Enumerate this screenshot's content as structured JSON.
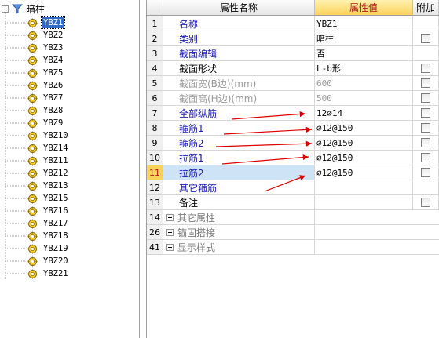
{
  "tree": {
    "root_label": "暗柱",
    "items": [
      "YBZ1",
      "YBZ2",
      "YBZ3",
      "YBZ4",
      "YBZ5",
      "YBZ6",
      "YBZ7",
      "YBZ8",
      "YBZ9",
      "YBZ10",
      "YBZ14",
      "YBZ11",
      "YBZ12",
      "YBZ13",
      "YBZ15",
      "YBZ16",
      "YBZ17",
      "YBZ18",
      "YBZ19",
      "YBZ20",
      "YBZ21"
    ],
    "selected": "YBZ1"
  },
  "grid": {
    "headers": {
      "name": "属性名称",
      "value": "属性值",
      "extra": "附加"
    },
    "rows": [
      {
        "num": "1",
        "name": "名称",
        "value": "YBZ1",
        "checkbox": false
      },
      {
        "num": "2",
        "name": "类别",
        "value": "暗柱",
        "checkbox": true
      },
      {
        "num": "3",
        "name": "截面编辑",
        "value": "否",
        "checkbox": false
      },
      {
        "num": "4",
        "name": "截面形状",
        "value": "L-b形",
        "checkbox": true
      },
      {
        "num": "5",
        "name": "截面宽(B边)(mm)",
        "value": "600",
        "checkbox": true
      },
      {
        "num": "6",
        "name": "截面高(H边)(mm)",
        "value": "500",
        "checkbox": true
      },
      {
        "num": "7",
        "name": "全部纵筋",
        "value": "12⌀14",
        "checkbox": true
      },
      {
        "num": "8",
        "name": "箍筋1",
        "value": "⌀12@150",
        "checkbox": true
      },
      {
        "num": "9",
        "name": "箍筋2",
        "value": "⌀12@150",
        "checkbox": true
      },
      {
        "num": "10",
        "name": "拉筋1",
        "value": "⌀12@150",
        "checkbox": true
      },
      {
        "num": "11",
        "name": "拉筋2",
        "value": "⌀12@150",
        "checkbox": true
      },
      {
        "num": "12",
        "name": "其它箍筋",
        "value": "",
        "checkbox": false
      },
      {
        "num": "13",
        "name": "备注",
        "value": "",
        "checkbox": true
      }
    ],
    "groups": [
      {
        "num": "14",
        "name": "其它属性"
      },
      {
        "num": "26",
        "name": "锚固搭接"
      },
      {
        "num": "41",
        "name": "显示样式"
      }
    ]
  },
  "colors": {
    "selection": "#3169c6",
    "header_highlight": "#fbd35c",
    "arrow": "#e00000",
    "blue_text": "#1b1bb8"
  }
}
